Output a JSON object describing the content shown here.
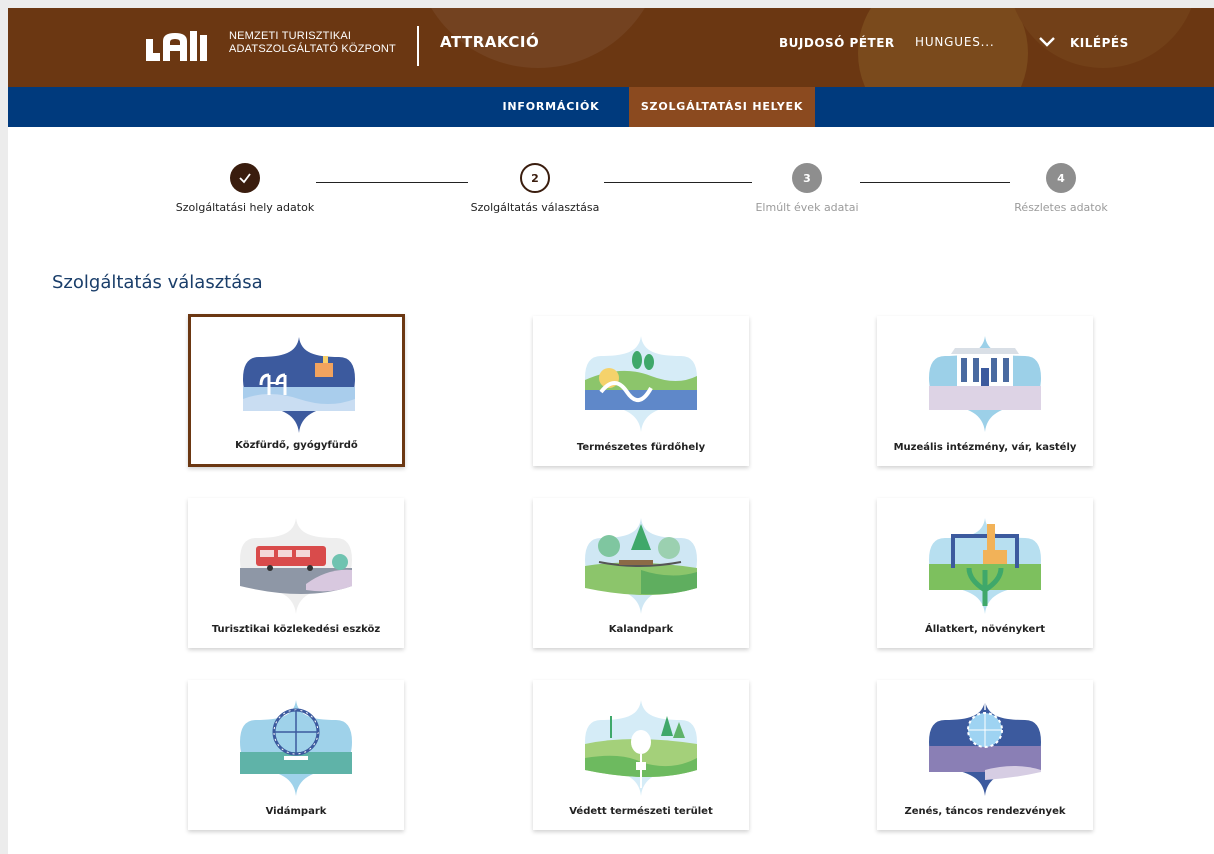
{
  "header": {
    "org_line1": "NEMZETI TURISZTIKAI",
    "org_line2": "ADATSZOLGÁLTATÓ KÖZPONT",
    "app_title": "ATTRAKCIÓ",
    "user_name": "BUJDOSÓ PÉTER",
    "org_select": "HUNGUES...",
    "logout_label": "KILÉPÉS"
  },
  "nav": {
    "tabs": [
      {
        "label": "INFORMÁCIÓK",
        "active": false
      },
      {
        "label": "SZOLGÁLTATÁSI HELYEK",
        "active": true
      }
    ]
  },
  "stepper": {
    "steps": [
      {
        "number": "",
        "label": "Szolgáltatási hely adatok",
        "state": "done"
      },
      {
        "number": "2",
        "label": "Szolgáltatás választása",
        "state": "current"
      },
      {
        "number": "3",
        "label": "Elmúlt évek adatai",
        "state": "future"
      },
      {
        "number": "4",
        "label": "Részletes adatok",
        "state": "future"
      }
    ]
  },
  "section_title": "Szolgáltatás választása",
  "services": [
    {
      "label": "Közfürdő, gyógyfürdő",
      "icon": "bath-icon",
      "selected": true
    },
    {
      "label": "Természetes fürdőhely",
      "icon": "natural-bath-icon",
      "selected": false
    },
    {
      "label": "Muzeális intézmény, vár, kastély",
      "icon": "museum-icon",
      "selected": false
    },
    {
      "label": "Turisztikai közlekedési eszköz",
      "icon": "bus-icon",
      "selected": false
    },
    {
      "label": "Kalandpark",
      "icon": "adventure-park-icon",
      "selected": false
    },
    {
      "label": "Állatkert, növénykert",
      "icon": "zoo-icon",
      "selected": false
    },
    {
      "label": "Vidámpark",
      "icon": "ferris-wheel-icon",
      "selected": false
    },
    {
      "label": "Védett természeti terület",
      "icon": "protected-area-icon",
      "selected": false
    },
    {
      "label": "Zenés, táncos rendezvények",
      "icon": "disco-ball-icon",
      "selected": false
    }
  ],
  "colors": {
    "header_brown": "#6b3712",
    "nav_blue": "#003a7d",
    "active_tab": "#8b4a1f",
    "step_done": "#3a1d0e",
    "step_future": "#8e8e8e",
    "title_blue": "#1a3e6a"
  }
}
